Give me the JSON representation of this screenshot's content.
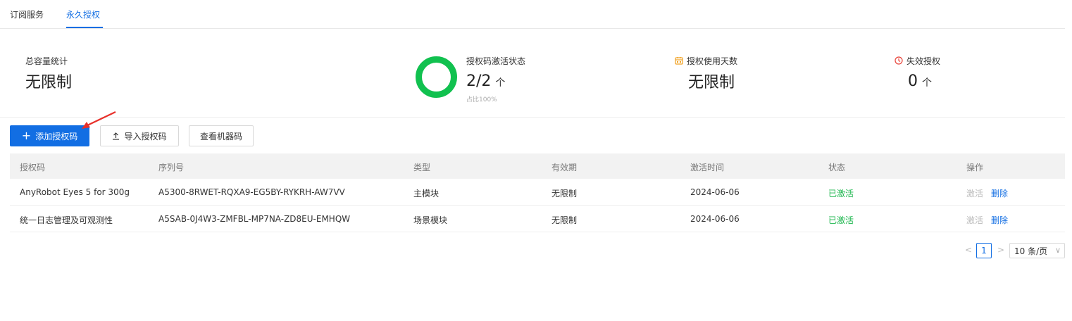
{
  "tabs": {
    "items": [
      {
        "label": "订阅服务"
      },
      {
        "label": "永久授权"
      }
    ],
    "active_index": 1
  },
  "stats": {
    "capacity": {
      "label": "总容量统计",
      "value": "无限制"
    },
    "activation": {
      "label": "授权码激活状态",
      "value": "2/2",
      "unit": "个",
      "sub": "占比100%",
      "percent": 100
    },
    "days": {
      "label": "授权使用天数",
      "value": "无限制"
    },
    "invalid": {
      "label": "失效授权",
      "value": "0",
      "unit": "个"
    }
  },
  "toolbar": {
    "add_label": "添加授权码",
    "import_label": "导入授权码",
    "machine_label": "查看机器码"
  },
  "table": {
    "columns": [
      "授权码",
      "序列号",
      "类型",
      "有效期",
      "激活时间",
      "状态",
      "操作"
    ],
    "rows": [
      {
        "code": "AnyRobot Eyes 5 for 300g",
        "serial": "A5300-8RWET-RQXA9-EG5BY-RYKRH-AW7VV",
        "type": "主模块",
        "validity": "无限制",
        "activated": "2024-06-06",
        "status": "已激活",
        "op_activate": "激活",
        "op_delete": "删除"
      },
      {
        "code": "统一日志管理及可观测性",
        "serial": "A5SAB-0J4W3-ZMFBL-MP7NA-ZD8EU-EMHQW",
        "type": "场景模块",
        "validity": "无限制",
        "activated": "2024-06-06",
        "status": "已激活",
        "op_activate": "激活",
        "op_delete": "删除"
      }
    ]
  },
  "pagination": {
    "prev": "<",
    "current": "1",
    "next": ">",
    "page_size": "10 条/页"
  },
  "colors": {
    "primary": "#126ee3",
    "success": "#1fb74f",
    "ring": "#11c14f",
    "calendar_icon": "#f0a020",
    "invalid_icon": "#e8443a",
    "annotation_arrow": "#e8302a"
  },
  "icons": {
    "add": "plus-icon",
    "import": "upload-icon",
    "days": "calendar-icon",
    "invalid": "clock-warning-icon",
    "page_size": "chevron-down-icon"
  }
}
